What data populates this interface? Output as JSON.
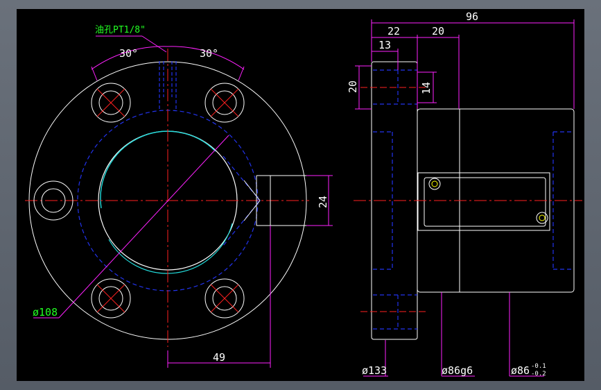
{
  "colors": {
    "background": "#000000",
    "outline": "#ffffff",
    "hidden": "#2233ee",
    "center": "#ff2020",
    "dimension": "#ff22ff",
    "text_dim": "#ffffff",
    "text_green": "#22ff22",
    "cyan": "#22dddd",
    "yellow": "#ffff00"
  },
  "front_view": {
    "oil_hole_label": "油孔PT1/8\"",
    "angle_left": "30°",
    "angle_right": "30°",
    "pcd_label": "ø108",
    "dim_24": "24",
    "dim_49": "49"
  },
  "side_view": {
    "dim_96": "96",
    "dim_22": "22",
    "dim_20_top": "20",
    "dim_13": "13",
    "dim_20_left": "20",
    "dim_14": "14",
    "dia_133": "ø133",
    "dia_86g6": "ø86g6",
    "dia_86": "ø86",
    "tol_upper": "-0.1",
    "tol_lower": "-0.2"
  }
}
